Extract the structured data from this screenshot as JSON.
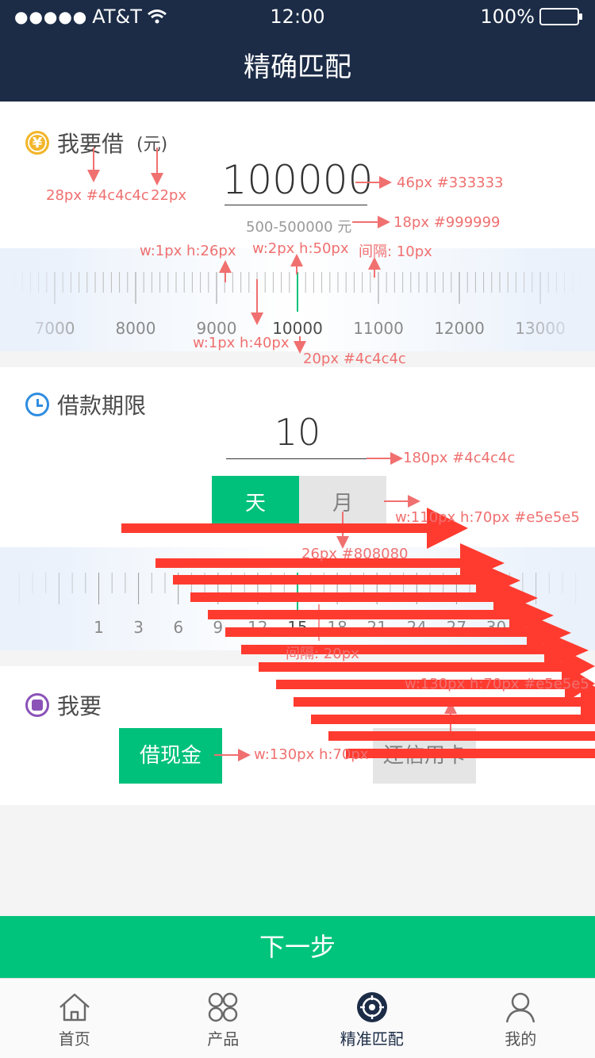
{
  "status": {
    "signal": "●●●●●",
    "carrier": "AT&T",
    "time": "12:00",
    "battery": "100%"
  },
  "nav": {
    "title": "精确匹配"
  },
  "amount": {
    "label": "我要借",
    "unit": "(元)",
    "value": "100000",
    "range": "500-500000 元",
    "ruler": {
      "labels": [
        "7000",
        "8000",
        "9000",
        "10000",
        "11000",
        "12000",
        "13000"
      ],
      "current": 10000
    }
  },
  "term": {
    "label": "借款期限",
    "value": "10",
    "units": [
      {
        "label": "天",
        "active": true
      },
      {
        "label": "月",
        "active": false
      }
    ],
    "ruler": {
      "labels": [
        "1",
        "3",
        "6",
        "9",
        "12",
        "15",
        "18",
        "21",
        "24",
        "27",
        "30"
      ],
      "current": 15
    }
  },
  "want": {
    "label": "我要",
    "options": [
      {
        "label": "借现金",
        "active": true
      },
      {
        "label": "还信用卡",
        "active": false
      }
    ]
  },
  "next_button": "下一步",
  "tabs": [
    {
      "label": "首页",
      "icon": "home-icon",
      "active": false
    },
    {
      "label": "产品",
      "icon": "products-icon",
      "active": false
    },
    {
      "label": "精准匹配",
      "icon": "target-icon",
      "active": true
    },
    {
      "label": "我的",
      "icon": "user-icon",
      "active": false
    }
  ],
  "annotations": {
    "a_label": "28px #4c4c4c",
    "a_unit": "22px",
    "a_value": "46px #333333",
    "a_range": "18px #999999",
    "a_tick_small": "w:1px  h:26px",
    "a_tick_center": "w:2px  h:50px",
    "a_tick_gap": "间隔:  10px",
    "a_tick_major": "w:1px  h:40px",
    "a_ruler_label": "20px #4c4c4c",
    "a_term_value": "180px #4c4c4c",
    "a_unit_btn": "w:110px  h:70px  #e5e5e5",
    "a_unit_btn_font": "26px #808080",
    "a_term_gap": "间隔:  20px",
    "a_want_btn2": "w:130px  h:70px  #e5e5e5",
    "a_want_btn": "w:130px  h:70px"
  },
  "colors": {
    "nav": "#1c2c47",
    "accent": "#00c17c",
    "arrow": "#ff3b30"
  }
}
